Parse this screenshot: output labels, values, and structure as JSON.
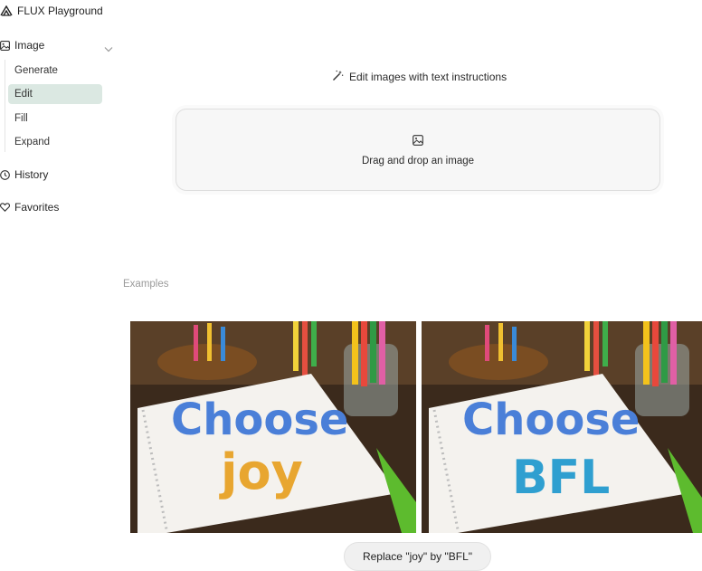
{
  "app": {
    "title": "FLUX Playground"
  },
  "sidebar": {
    "image_section": {
      "label": "Image"
    },
    "sub_items": [
      {
        "label": "Generate",
        "active": false
      },
      {
        "label": "Edit",
        "active": true
      },
      {
        "label": "Fill",
        "active": false
      },
      {
        "label": "Expand",
        "active": false
      }
    ],
    "history": {
      "label": "History"
    },
    "favorites": {
      "label": "Favorites"
    }
  },
  "main": {
    "title": "Edit images with text instructions",
    "dropzone": {
      "text": "Drag and drop an image"
    },
    "examples": {
      "label": "Examples",
      "items": [
        {
          "before_text_line1": "Choose",
          "before_text_line2": "joy",
          "after_text_line1": "Choose",
          "after_text_line2": "BFL",
          "caption": "Replace \"joy\" by \"BFL\""
        }
      ]
    }
  },
  "colors": {
    "active_bg": "#dbe8e2",
    "dropzone_bg": "#f7f7f7",
    "muted_text": "#9a9a9a"
  }
}
